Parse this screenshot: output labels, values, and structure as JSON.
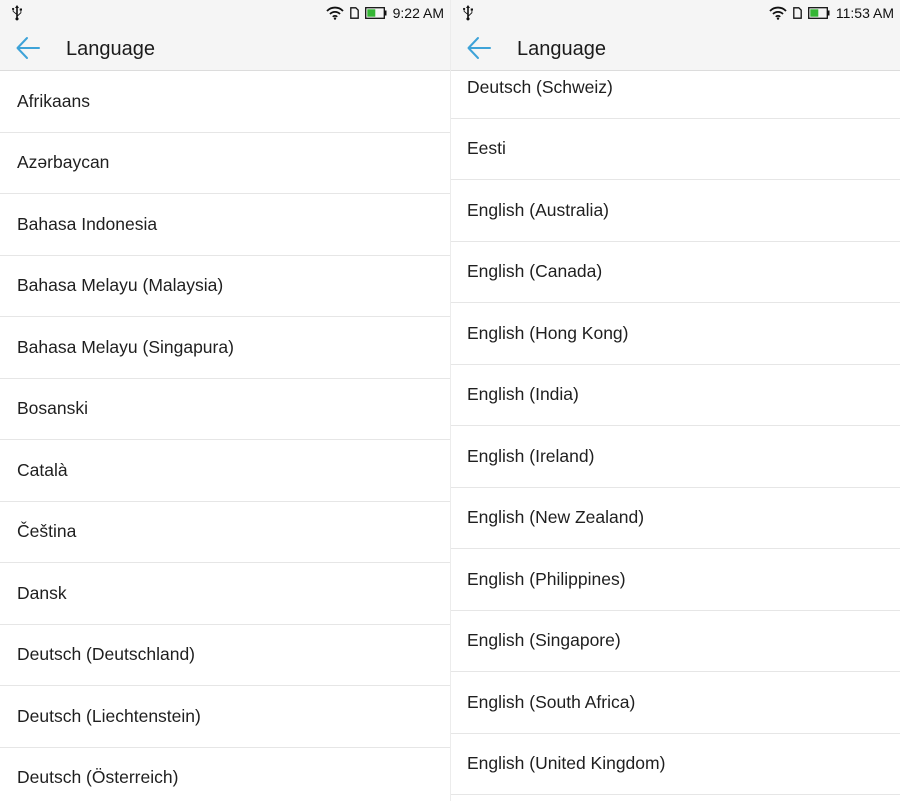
{
  "left_screen": {
    "status": {
      "time": "9:22 AM"
    },
    "toolbar": {
      "title": "Language"
    },
    "languages": [
      "Afrikaans",
      "Azərbaycan",
      "Bahasa Indonesia",
      "Bahasa Melayu (Malaysia)",
      "Bahasa Melayu (Singapura)",
      "Bosanski",
      "Català",
      "Čeština",
      "Dansk",
      "Deutsch (Deutschland)",
      "Deutsch (Liechtenstein)",
      "Deutsch (Österreich)"
    ]
  },
  "right_screen": {
    "status": {
      "time": "11:53 AM"
    },
    "toolbar": {
      "title": "Language"
    },
    "languages": [
      "Deutsch (Schweiz)",
      "Eesti",
      "English (Australia)",
      "English (Canada)",
      "English (Hong Kong)",
      "English (India)",
      "English (Ireland)",
      "English (New Zealand)",
      "English (Philippines)",
      "English (Singapore)",
      "English (South Africa)",
      "English (United Kingdom)"
    ]
  },
  "colors": {
    "accent": "#3ea3d8",
    "battery": "#35b635",
    "header_bg": "#f5f5f5",
    "divider": "#e6e6e6"
  },
  "icons": [
    "usb-icon",
    "wifi-icon",
    "sim-icon",
    "battery-icon",
    "back-arrow-icon"
  ]
}
